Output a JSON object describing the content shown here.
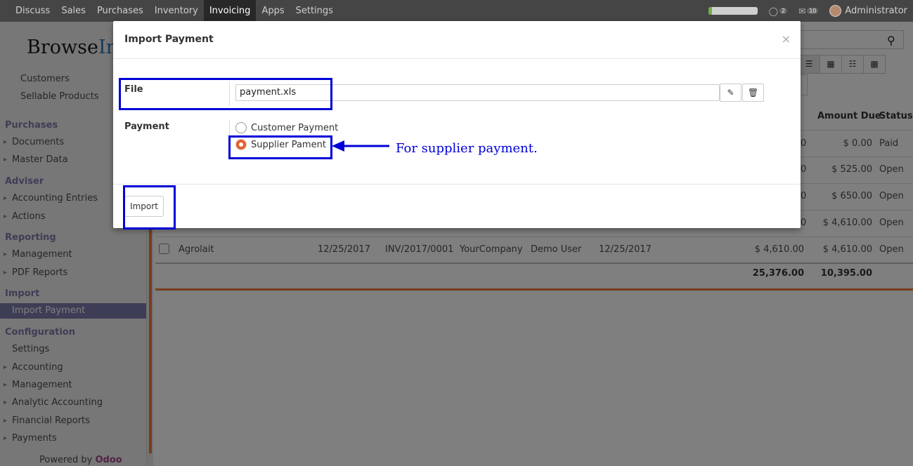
{
  "topbar": {
    "menu": [
      "Discuss",
      "Sales",
      "Purchases",
      "Inventory",
      "Invoicing",
      "Apps",
      "Settings"
    ],
    "active": "Invoicing",
    "chat_count": "2",
    "message_count": "10",
    "user": "Administrator"
  },
  "sidebar": {
    "logo_text": "Browse",
    "logo_accent": "Inf",
    "items_top": [
      "Customers",
      "Sellable Products"
    ],
    "purchases_header": "Purchases",
    "purchases_items": [
      "Documents",
      "Master Data"
    ],
    "adviser_header": "Adviser",
    "adviser_items": [
      "Accounting Entries",
      "Actions"
    ],
    "reporting_header": "Reporting",
    "reporting_items": [
      "Management",
      "PDF Reports"
    ],
    "import_header": "Import",
    "import_active": "Import Payment",
    "configuration_header": "Configuration",
    "configuration_items": [
      "Settings",
      "Accounting",
      "Management",
      "Analytic Accounting",
      "Financial Reports",
      "Payments"
    ],
    "powered_by": "Powered by",
    "powered_brand": "Odoo"
  },
  "list": {
    "col_amount_due": "Amount Due",
    "col_status": "Status",
    "rows": [
      {
        "amount_due": "$ 0.00",
        "status": "Paid"
      },
      {
        "amount_due": "$ 525.00",
        "status": "Open"
      },
      {
        "amount_due": "$ 650.00",
        "status": "Open"
      },
      {
        "amount_due": "$ 4,610.00",
        "status": "Open"
      }
    ],
    "last_row": {
      "partner": "Agrolait",
      "date": "12/25/2017",
      "number": "INV/2017/0001",
      "company": "YourCompany",
      "salesperson": "Demo User",
      "due_date": "12/25/2017",
      "total": "$ 4,610.00",
      "amount_due": "$ 4,610.00",
      "status": "Open"
    },
    "total_sum": "25,376.00",
    "due_sum": "10,395.00"
  },
  "modal": {
    "title": "Import Payment",
    "close": "×",
    "file_label": "File",
    "file_value": "payment.xls",
    "payment_label": "Payment",
    "options": [
      "Customer Payment",
      "Supplier Pament"
    ],
    "selected": "Supplier Pament",
    "import_button": "Import"
  },
  "annotation": {
    "text": "For supplier payment.",
    "color": "#0000d8"
  },
  "colors": {
    "brand": "#7c7bad",
    "accent": "#f0793b",
    "radio_checked": "#e8612c"
  }
}
